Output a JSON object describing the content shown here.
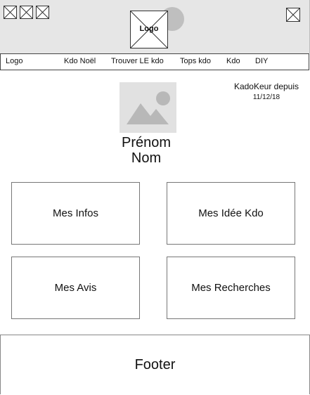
{
  "header": {
    "logo_label": "Logo",
    "window_controls": [
      "placeholder-icon",
      "placeholder-icon",
      "placeholder-icon"
    ],
    "close_control": "placeholder-icon"
  },
  "nav": {
    "items": [
      {
        "label": "Logo"
      },
      {
        "label": "Kdo Noël"
      },
      {
        "label": "Trouver LE kdo"
      },
      {
        "label": "Tops kdo"
      },
      {
        "label": "Kdo"
      },
      {
        "label": "DIY"
      }
    ]
  },
  "profile": {
    "avatar_icon": "image-placeholder-icon",
    "member_since_label": "KadoKeur depuis",
    "member_since_date": "11/12/18",
    "first_name": "Prénom",
    "last_name": "Nom"
  },
  "cards": [
    {
      "label": "Mes Infos"
    },
    {
      "label": "Mes Idée Kdo"
    },
    {
      "label": "Mes Avis"
    },
    {
      "label": "Mes Recherches"
    }
  ],
  "footer": {
    "label": "Footer"
  }
}
